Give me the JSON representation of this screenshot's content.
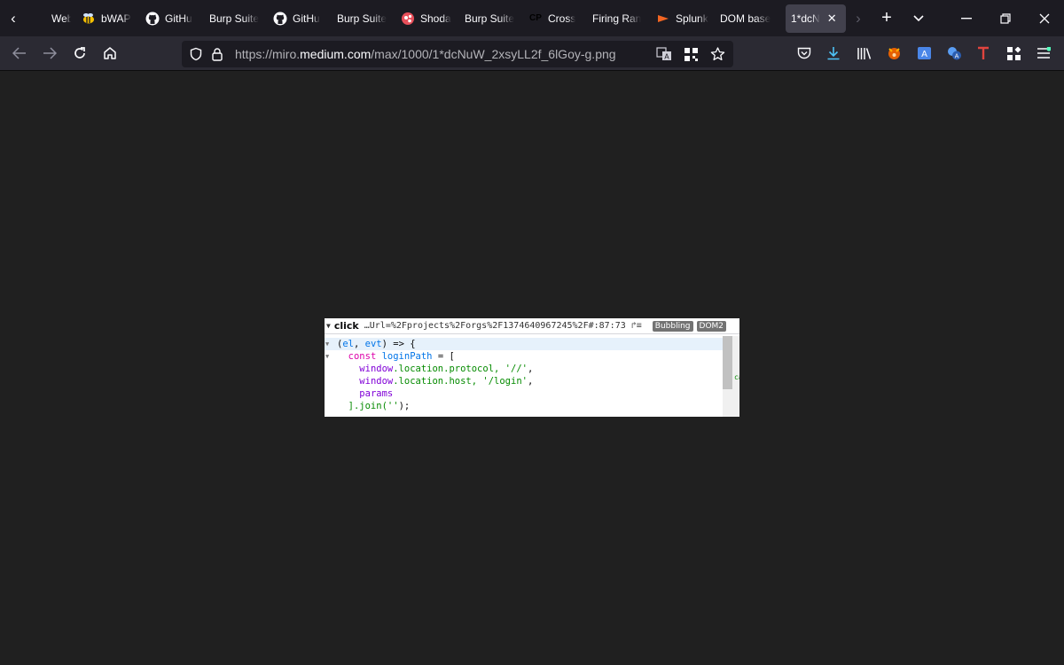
{
  "tabs": [
    {
      "label": "Web A",
      "icon": "globe-icon",
      "active": false
    },
    {
      "label": "bWAP",
      "icon": "bee-icon",
      "active": false
    },
    {
      "label": "GitHu",
      "icon": "github-icon",
      "active": false
    },
    {
      "label": "Burp Suite",
      "icon": "",
      "active": false
    },
    {
      "label": "GitHu",
      "icon": "github-icon",
      "active": false
    },
    {
      "label": "Burp Suite",
      "icon": "",
      "active": false
    },
    {
      "label": "Shoda",
      "icon": "shodan-icon",
      "active": false
    },
    {
      "label": "Burp Suite",
      "icon": "",
      "active": false
    },
    {
      "label": "Cross",
      "icon": "cp-icon",
      "active": false
    },
    {
      "label": "Firing Ran",
      "icon": "",
      "active": false
    },
    {
      "label": "Splunk",
      "icon": "splunk-icon",
      "active": false
    },
    {
      "label": "DOM base",
      "icon": "",
      "active": false
    },
    {
      "label": "1*dcN",
      "icon": "",
      "active": true
    }
  ],
  "cp_favicon_text": "CP",
  "url": {
    "prefix": "https://miro.",
    "host": "medium.com",
    "path": "/max/1000/1*dcNuW_2xsyLL2f_6lGoy-g.png"
  },
  "image": {
    "event_name": "click",
    "source": "…Url=%2Fprojects%2Forgs%2F1374640967245%2F#:87:73",
    "badges": [
      "Bubbling",
      "DOM2"
    ],
    "code_lines": [
      [
        {
          "t": "(",
          "c": "pl"
        },
        {
          "t": "el",
          "c": "id"
        },
        {
          "t": ", ",
          "c": "pl"
        },
        {
          "t": "evt",
          "c": "id"
        },
        {
          "t": ") => {",
          "c": "pl"
        }
      ],
      [
        {
          "t": "  ",
          "c": "pl"
        },
        {
          "t": "const ",
          "c": "kw"
        },
        {
          "t": "loginPath",
          "c": "id"
        },
        {
          "t": " = [",
          "c": "pl"
        }
      ],
      [
        {
          "t": "    ",
          "c": "pl"
        },
        {
          "t": "window",
          "c": "pr"
        },
        {
          "t": ".location.protocol, ",
          "c": "st"
        },
        {
          "t": "'//'",
          "c": "st"
        },
        {
          "t": ",",
          "c": "pl"
        }
      ],
      [
        {
          "t": "    ",
          "c": "pl"
        },
        {
          "t": "window",
          "c": "pr"
        },
        {
          "t": ".location.host, ",
          "c": "st"
        },
        {
          "t": "'/login'",
          "c": "st"
        },
        {
          "t": ",",
          "c": "pl"
        }
      ],
      [
        {
          "t": "    ",
          "c": "pl"
        },
        {
          "t": "params",
          "c": "pr"
        }
      ],
      [
        {
          "t": "  ].join(",
          "c": "st"
        },
        {
          "t": "''",
          "c": "st"
        },
        {
          "t": ");",
          "c": "pl"
        }
      ]
    ],
    "clipped_fragment": "ca"
  }
}
